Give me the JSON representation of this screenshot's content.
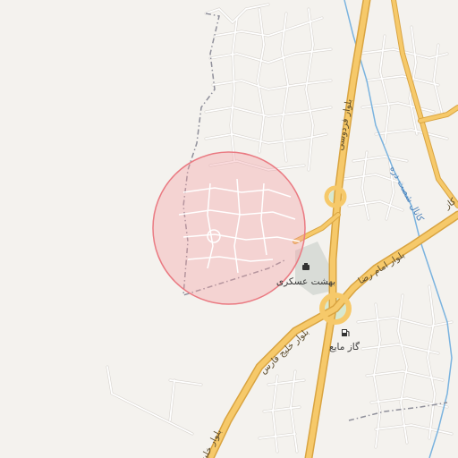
{
  "map": {
    "colors": {
      "background": "#f4f2ee",
      "minor_road": "#ffffff",
      "minor_road_casing": "#d8d4cf",
      "major_road": "#f6c96a",
      "major_road_casing": "#d9a441",
      "water": "#7ab3df",
      "boundary": "#8f8f9a",
      "highlight_fill": "#f5a0a6",
      "highlight_stroke": "#ea7a82",
      "park": "#d7e8cf",
      "cemetery": "#d9dcd7"
    },
    "road_labels": {
      "ferdowsi": "بلوار فردوسی",
      "imam_reza": "بلوار امام رضا",
      "khalij_fars": "بلوار خلیج فارس",
      "khalij_fars_short": "بلوار خلیج",
      "edge": "کاز"
    },
    "canal_label": "کانال شصت دره",
    "poi": {
      "cemetery_label": "بهشت عسکری",
      "cemetery_icon": "cemetery-icon",
      "gas_label": "گاز مایع",
      "gas_icon": "fuel-pump-icon"
    },
    "highlight": {
      "shape": "circle",
      "label": ""
    }
  }
}
